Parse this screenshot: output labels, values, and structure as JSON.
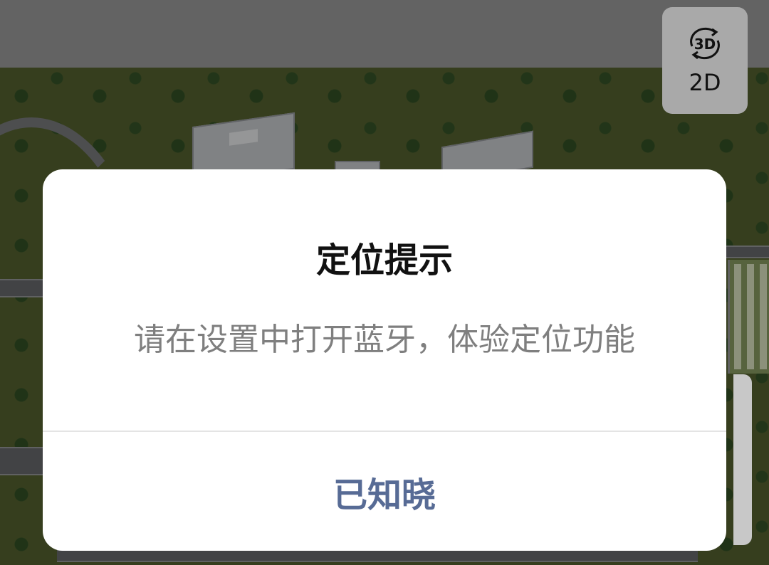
{
  "view_toggle": {
    "icon_text": "3D",
    "label": "2D"
  },
  "dialog": {
    "title": "定位提示",
    "message": "请在设置中打开蓝牙，体验定位功能",
    "confirm_label": "已知晓"
  },
  "colors": {
    "confirm_text": "#576b95",
    "title_text": "#111111",
    "message_text": "#7f7f7f",
    "toggle_bg": "#a9a9a9"
  }
}
